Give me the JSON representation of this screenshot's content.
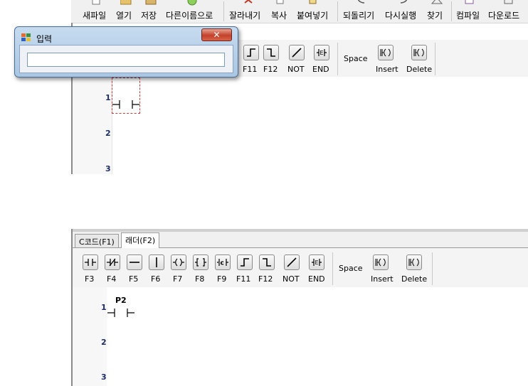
{
  "top": {
    "menu": [
      {
        "label": "새파일",
        "icon": "new-file-icon"
      },
      {
        "label": "열기",
        "icon": "open-folder-icon"
      },
      {
        "label": "저장",
        "icon": "save-icon"
      },
      {
        "label": "다른이름으로",
        "icon": "save-as-icon"
      },
      {
        "label": "잘라내기",
        "icon": "cut-icon"
      },
      {
        "label": "복사",
        "icon": "copy-icon"
      },
      {
        "label": "붙여넣기",
        "icon": "paste-icon"
      },
      {
        "label": "되돌리기",
        "icon": "undo-icon"
      },
      {
        "label": "다시실행",
        "icon": "redo-icon"
      },
      {
        "label": "찾기",
        "icon": "find-icon"
      },
      {
        "label": "컴파일",
        "icon": "compile-icon"
      },
      {
        "label": "다운로드",
        "icon": "download-icon"
      }
    ],
    "toolbar": [
      {
        "key": "F11",
        "icon": "rising-edge-icon"
      },
      {
        "key": "F12",
        "icon": "falling-edge-icon"
      },
      {
        "key": "NOT",
        "icon": "not-icon"
      },
      {
        "key": "END",
        "icon": "end-icon"
      }
    ],
    "space_label": "Space",
    "insert_label": "Insert",
    "delete_label": "Delete",
    "line_numbers": [
      "1",
      "2",
      "3"
    ]
  },
  "dialog": {
    "title": "입력",
    "close_symbol": "✕",
    "input_value": ""
  },
  "bottom": {
    "tabs": [
      {
        "label": "C코드(F1)",
        "active": false
      },
      {
        "label": "래더(F2)",
        "active": true
      }
    ],
    "toolbar": [
      {
        "key": "F3",
        "icon": "contact-no-icon"
      },
      {
        "key": "F4",
        "icon": "contact-nc-icon"
      },
      {
        "key": "F5",
        "icon": "horizontal-line-icon"
      },
      {
        "key": "F6",
        "icon": "vertical-line-icon"
      },
      {
        "key": "F7",
        "icon": "coil-icon"
      },
      {
        "key": "F8",
        "icon": "function-block-icon"
      },
      {
        "key": "F9",
        "icon": "c-block-icon"
      },
      {
        "key": "F11",
        "icon": "rising-edge-icon"
      },
      {
        "key": "F12",
        "icon": "falling-edge-icon"
      },
      {
        "key": "NOT",
        "icon": "not-icon"
      },
      {
        "key": "END",
        "icon": "end-icon"
      }
    ],
    "space_label": "Space",
    "insert_label": "Insert",
    "delete_label": "Delete",
    "line_numbers": [
      "1",
      "2",
      "3"
    ],
    "contact_label": "P2"
  }
}
